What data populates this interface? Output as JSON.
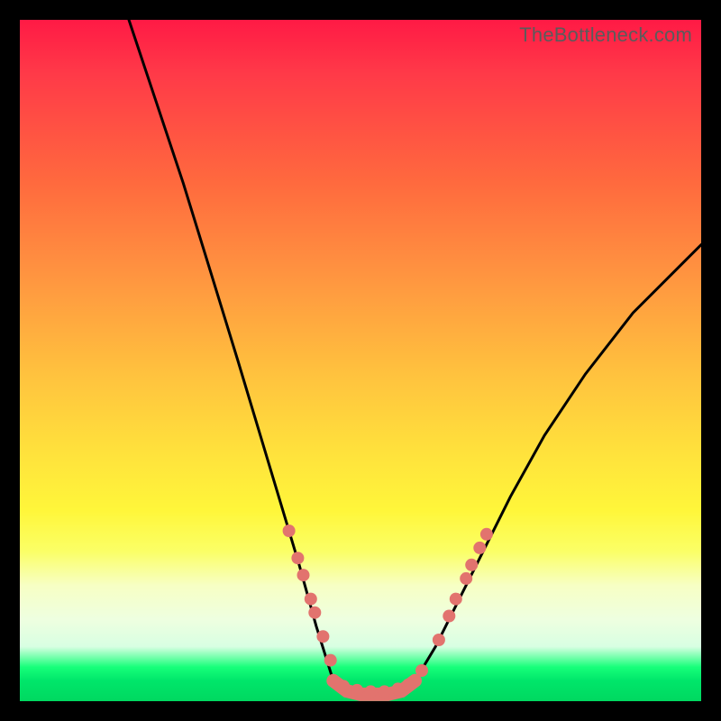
{
  "watermark": "TheBottleneck.com",
  "chart_data": {
    "type": "line",
    "title": "",
    "xlabel": "",
    "ylabel": "",
    "xlim": [
      0,
      100
    ],
    "ylim": [
      0,
      100
    ],
    "grid": false,
    "legend": false,
    "background_gradient_stops": [
      {
        "pos": 0,
        "color": "#ff1a45"
      },
      {
        "pos": 24,
        "color": "#ff6a3e"
      },
      {
        "pos": 52,
        "color": "#ffc23e"
      },
      {
        "pos": 72,
        "color": "#fff63a"
      },
      {
        "pos": 88,
        "color": "#eeffe0"
      },
      {
        "pos": 96,
        "color": "#00e66a"
      },
      {
        "pos": 100,
        "color": "#00d860"
      }
    ],
    "series": [
      {
        "name": "left-branch",
        "x": [
          16,
          20,
          24,
          28,
          32,
          35,
          38,
          41,
          43.5,
          46
        ],
        "y": [
          100,
          88,
          76,
          63,
          50,
          40,
          30,
          20,
          11,
          3
        ]
      },
      {
        "name": "valley-floor",
        "x": [
          46,
          48,
          50,
          52,
          54,
          56,
          58
        ],
        "y": [
          3,
          1.5,
          1,
          1,
          1,
          1.5,
          3
        ]
      },
      {
        "name": "right-branch",
        "x": [
          58,
          61,
          64,
          68,
          72,
          77,
          83,
          90,
          98,
          100
        ],
        "y": [
          3,
          8,
          14,
          22,
          30,
          39,
          48,
          57,
          65,
          67
        ]
      }
    ],
    "markers_left": [
      {
        "x": 39.5,
        "y": 25
      },
      {
        "x": 40.8,
        "y": 21
      },
      {
        "x": 41.6,
        "y": 18.5
      },
      {
        "x": 42.7,
        "y": 15
      },
      {
        "x": 43.3,
        "y": 13
      },
      {
        "x": 44.5,
        "y": 9.5
      },
      {
        "x": 45.6,
        "y": 6
      }
    ],
    "markers_floor": [
      {
        "x": 47.5,
        "y": 2.2
      },
      {
        "x": 49.5,
        "y": 1.6
      },
      {
        "x": 51.5,
        "y": 1.4
      },
      {
        "x": 53.5,
        "y": 1.4
      },
      {
        "x": 55.5,
        "y": 1.8
      },
      {
        "x": 57.0,
        "y": 2.4
      }
    ],
    "markers_right": [
      {
        "x": 59.0,
        "y": 4.5
      },
      {
        "x": 61.5,
        "y": 9
      },
      {
        "x": 63.0,
        "y": 12.5
      },
      {
        "x": 64.0,
        "y": 15
      },
      {
        "x": 65.5,
        "y": 18
      },
      {
        "x": 66.3,
        "y": 20
      },
      {
        "x": 67.5,
        "y": 22.5
      },
      {
        "x": 68.5,
        "y": 24.5
      }
    ],
    "marker_color": "#e2736e",
    "marker_radius_px": 7,
    "floor_band_color": "#e2736e"
  }
}
